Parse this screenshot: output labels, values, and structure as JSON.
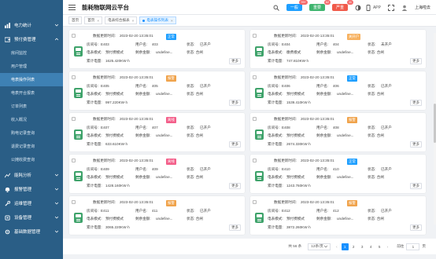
{
  "colors": {
    "sidebar": "#2a5e86",
    "sidebar_active": "#3e81b4",
    "accent": "#1890ff",
    "meter": "#3fa36b",
    "online": "#1e9fff",
    "alarm": "#f0a34b",
    "offline": "#f35f8a",
    "closed": "#f7b15f"
  },
  "header": {
    "title": "能耗物联网云平台",
    "btn1": "一般",
    "btn1_badge": "99+",
    "btn2": "重要",
    "btn2_badge": "62",
    "btn3": "严重",
    "btn3_badge": "11",
    "app": "APP",
    "city": "上海啦去"
  },
  "sidebar": {
    "g0": "电力统计",
    "g1": "预付费管理",
    "s0": "房间监控",
    "s1": "用户管理",
    "s2": "电表操作列表",
    "s3": "电表开合报表",
    "s4": "订单列表",
    "s5": "收入概况",
    "s6": "购电记录查询",
    "s7": "退费记录查询",
    "s8": "公摊收费查询",
    "g2": "能耗分析",
    "g3": "报警管理",
    "g4": "运维管理",
    "g5": "设备管理",
    "g6": "基础数据管理"
  },
  "tabs": {
    "t0": "首页",
    "t1": "首页",
    "t2": "电表综合报表",
    "t3": "电表操作列表"
  },
  "labels": {
    "update": "数据更新时间:",
    "room": "房间号:",
    "user": "用户名:",
    "state": "状态:",
    "mode": "电表模式:",
    "balance": "剩余金额:",
    "total": "累计电量:",
    "more": "更多"
  },
  "cards": [
    {
      "time": "2023-02-20 13:35:01",
      "status": "正常",
      "status_color": "#1e9fff",
      "room": "E403",
      "user": "403",
      "state": "已开户",
      "mode": "预付费模式",
      "balance": "undefine...",
      "switch": "状态: 合闸",
      "total": "1625.420KW·h"
    },
    {
      "time": "2023-02-20 13:35:01",
      "status": "关开户",
      "status_color": "#f7b15f",
      "room": "E404",
      "user": "404",
      "state": "未开户",
      "mode": "缴费模式",
      "balance": "undefine...",
      "switch": "状态: 合闸",
      "total": "747.810KW·h"
    },
    {
      "time": "2023-02-20 13:35:01",
      "status": "报警",
      "status_color": "#f0a34b",
      "room": "E405",
      "user": "405",
      "state": "已开户",
      "mode": "预付费模式",
      "balance": "undefine...",
      "switch": "状态: 合闸",
      "total": "997.220KW·h"
    },
    {
      "time": "2023-02-20 13:35:01",
      "status": "正常",
      "status_color": "#1e9fff",
      "room": "E406",
      "user": "406",
      "state": "已开户",
      "mode": "预付费模式",
      "balance": "undefine...",
      "switch": "状态: 合闸",
      "total": "1539.410KW·h"
    },
    {
      "time": "2023-02-20 13:35:01",
      "status": "离线",
      "status_color": "#f35f8a",
      "room": "E407",
      "user": "407",
      "state": "已开户",
      "mode": "预付费模式",
      "balance": "undefine...",
      "switch": "状态: 合闸",
      "total": "633.610KW·h"
    },
    {
      "time": "2023-02-20 13:35:01",
      "status": "报警",
      "status_color": "#f0a34b",
      "room": "E408",
      "user": "408",
      "state": "已开户",
      "mode": "预付费模式",
      "balance": "undefine...",
      "switch": "状态: 合闸",
      "total": "2674.330KW·h"
    },
    {
      "time": "2023-02-20 13:35:01",
      "status": "离线",
      "status_color": "#f35f8a",
      "room": "E409",
      "user": "409",
      "state": "已开户",
      "mode": "预付费模式",
      "balance": "undefine...",
      "switch": "状态: 合闸",
      "total": "1428.160KW·h"
    },
    {
      "time": "2023-02-20 13:35:01",
      "status": "正常",
      "status_color": "#1e9fff",
      "room": "E410",
      "user": "410",
      "state": "已开户",
      "mode": "预付费模式",
      "balance": "undefine...",
      "switch": "状态: 合闸",
      "total": "1243.760KW·h"
    },
    {
      "time": "2023-02-20 13:35:01",
      "status": "报警",
      "status_color": "#f0a34b",
      "room": "E411",
      "user": "411",
      "state": "已开户",
      "mode": "预付费模式",
      "balance": "undefine...",
      "switch": "状态: 合闸",
      "total": "3065.220KW·h"
    },
    {
      "time": "2023-02-20 13:35:01",
      "status": "报警",
      "status_color": "#f0a34b",
      "room": "E412",
      "user": "412",
      "state": "已开户",
      "mode": "预付费模式",
      "balance": "undefine...",
      "switch": "状态: 合闸",
      "total": "3872.260KW·h"
    }
  ],
  "pager": {
    "total": "共 56 条",
    "size": "12条/页",
    "p1": "1",
    "p2": "2",
    "p3": "3",
    "p4": "4",
    "p5": "5",
    "goto": "前往",
    "input": "1",
    "page": "页"
  }
}
